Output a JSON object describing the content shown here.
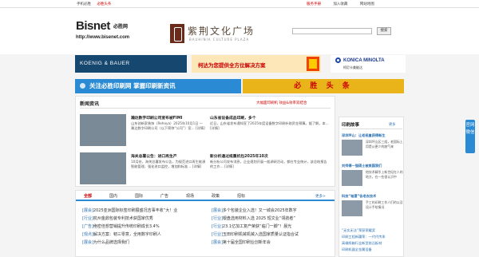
{
  "topbar": {
    "left": [
      "手机必胜",
      "必胜头条"
    ],
    "right": [
      "服务手册",
      "加入收藏",
      "网站地图"
    ]
  },
  "header": {
    "logo_main": "Bisnet",
    "logo_cn": "必胜网",
    "logo_url": "http://www.bisenet.com",
    "bauhinia_title": "紫荆文化广场",
    "bauhinia_sub": "BAUHINIA CULTURE PLAZA",
    "search_placeholder": "",
    "search_button": "搜索"
  },
  "ads": {
    "koenig": "KOENIG & BAUER",
    "kodak": "柯达为您提供全方位解决方案",
    "konica_main": "KONICA MINOLTA",
    "konica_sub": "柯尼卡美能达"
  },
  "banners": {
    "left": "关注必胜印刷网  掌握印刷新资讯",
    "right": "必 胜 头 条"
  },
  "news": {
    "heading": "新闻资讯",
    "heading_right": "大幅面印刷机 效益&效率双结合",
    "items": [
      {
        "title": "瀚达数字印刷公司宣布被FIMI",
        "desc": "山东创新家装饰（Rehoya）2025年10月1日 — 瀚达数字印刷公司（以下简称“公司”）宣… [详情]"
      },
      {
        "title": "山东省设备成品印刷，多个",
        "desc": "近日，山东省发布通知宣了2025年度设备数字印刷补助资金预算。据了解，本… [详情]"
      },
      {
        "title": "海关总署公告：进口再生产",
        "desc": "10月份，海关总署发布公告，为规范进口再生能源智能管理，强化进口监控，增加和标准… [详情]"
      },
      {
        "title": "新分析通过纸重机包2025年10次",
        "desc": "新分析公司发布消息，企业规划开展一般调研活动，都在专业统计，该总结报告的工作… [详情]"
      }
    ]
  },
  "tabs": {
    "labels": [
      "全部",
      "国内",
      "国际",
      "广告",
      "现场",
      "政策",
      "招标"
    ],
    "more": "更多>",
    "left_list": [
      {
        "tag": "[展会]",
        "text": "2025亚洲国际标签印刷展盛况吉事丰收“大！业"
      },
      {
        "tag": "[行业]",
        "text": "杭州金鼎包装专利技术获国家优秀"
      },
      {
        "tag": "[广告]",
        "text": "绝密佳想营销提升传统印刷成长3.4%"
      },
      {
        "tag": "[观点]",
        "text": "解决方案：韧三零意，全用数字印刷人"
      },
      {
        "tag": "[展会]",
        "text": "为什么品牌选择我们"
      }
    ],
    "right_list": [
      {
        "tag": "[展会]",
        "text": "多个包装企业入选！又一城会2025年数字"
      },
      {
        "tag": "[行业]",
        "text": "银盘选用材料入选 2025 短文业“领航者”"
      },
      {
        "tag": "[行业]",
        "text": "23.1亿加工复产荣获“临门一脚”！晨光"
      },
      {
        "tag": "[行业]",
        "text": "玉田印刷机械机械入选国家质量认证指合试"
      },
      {
        "tag": "[展会]",
        "text": "第十届全国印刷业创新年会"
      }
    ]
  },
  "side": {
    "heading": "印刷故事",
    "more": "更多",
    "items": [
      {
        "title": "深圳坪山：让老纸盒获得新生",
        "desc": "深圳坪山区三组，老国际上用是从更少的废气来"
      },
      {
        "title": "刘师傅一强硕士被美国我们",
        "desc": "他技术精华上新世纪在人的地方，在一些很认识中"
      },
      {
        "title": "科技“袖罩”告老去技术",
        "desc": "手工的印刷工作人们的以及设计手绘情况"
      }
    ],
    "links": [
      "“无实无法”荣获荣耀奖",
      "印刷工程新疆荣：一代代传承",
      "高端纸箱行业新型前沿板材",
      "印刷机器全金属设备"
    ]
  },
  "float": {
    "text": "官网微信"
  }
}
